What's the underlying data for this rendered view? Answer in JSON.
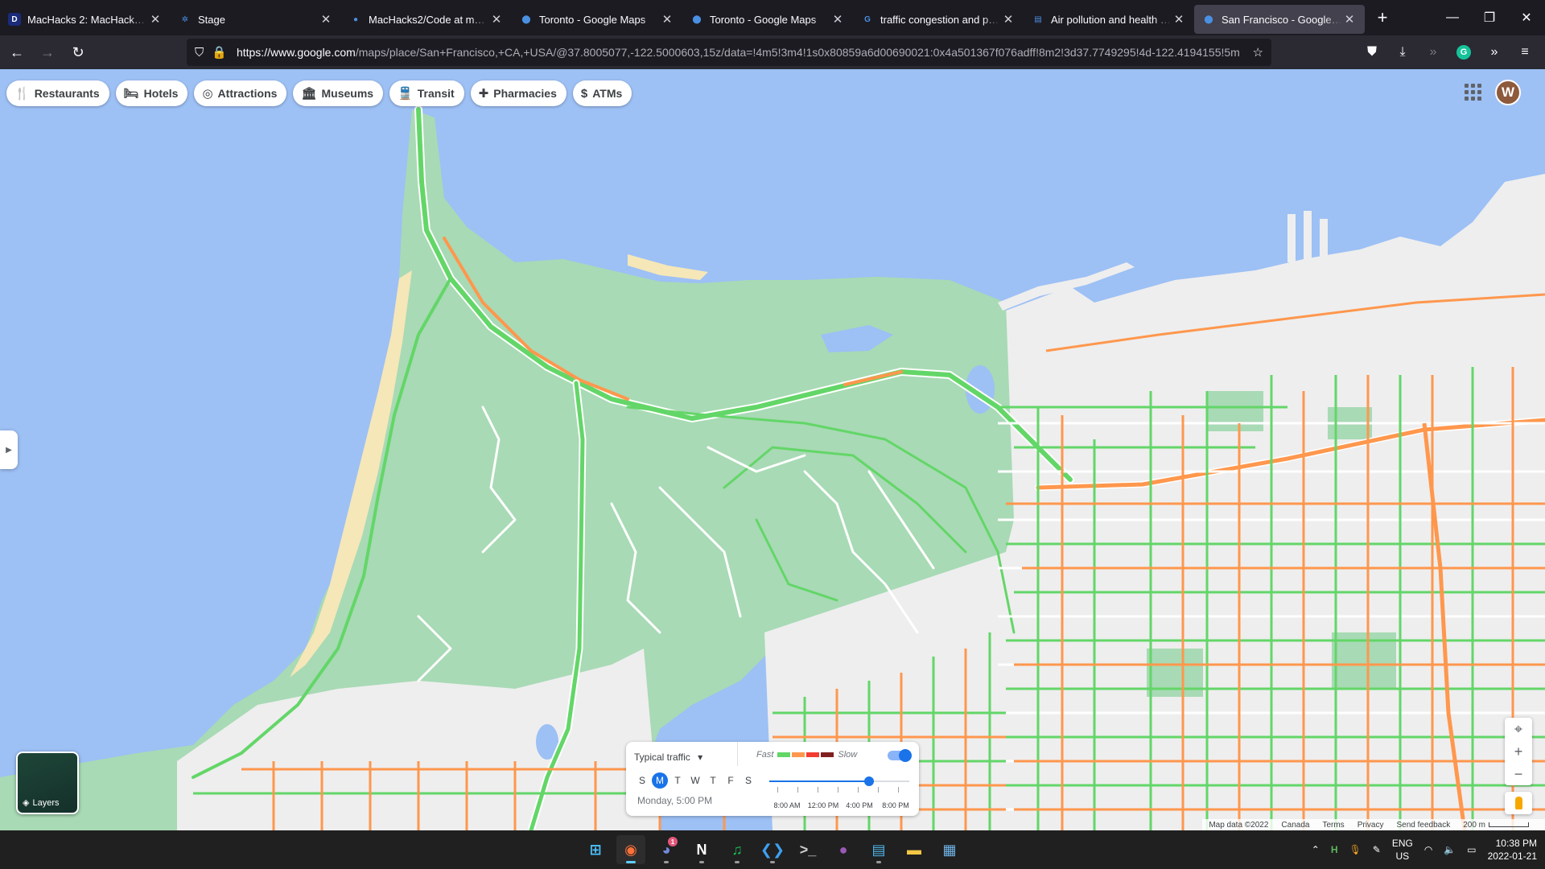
{
  "browser": {
    "tabs": [
      {
        "title": "MacHacks 2: MacHacks 2 is ...",
        "favicon": "D",
        "favicon_bg": "#1a2b7a",
        "active": false
      },
      {
        "title": "Stage",
        "favicon": "✲",
        "favicon_bg": "#1c1b22",
        "active": false
      },
      {
        "title": "MacHacks2/Code at main · d...",
        "favicon": "●",
        "favicon_bg": "#1c1b22",
        "active": false
      },
      {
        "title": "Toronto - Google Maps",
        "favicon": "⬤",
        "favicon_bg": "#1c1b22",
        "active": false
      },
      {
        "title": "Toronto - Google Maps",
        "favicon": "⬤",
        "favicon_bg": "#1c1b22",
        "active": false
      },
      {
        "title": "traffic congestion and polluti...",
        "favicon": "G",
        "favicon_bg": "#1c1b22",
        "active": false
      },
      {
        "title": "Air pollution and health risks ...",
        "favicon": "▤",
        "favicon_bg": "#1c1b22",
        "active": false
      },
      {
        "title": "San Francisco - Google Maps",
        "favicon": "⬤",
        "favicon_bg": "#42414d",
        "active": true
      }
    ],
    "url_host": "https://www.google.com",
    "url_rest": "/maps/place/San+Francisco,+CA,+USA/@37.8005077,-122.5000603,15z/data=!4m5!3m4!1s0x80859a6d00690021:0x4a501367f076adff!8m2!3d37.7749295!4d-122.4194155!5m"
  },
  "maps": {
    "chips": [
      {
        "label": "Restaurants",
        "icon": "fork-knife-icon",
        "glyph": "🍴"
      },
      {
        "label": "Hotels",
        "icon": "bed-icon",
        "glyph": "🛏"
      },
      {
        "label": "Attractions",
        "icon": "camera-icon",
        "glyph": "◎"
      },
      {
        "label": "Museums",
        "icon": "museum-icon",
        "glyph": "🏛"
      },
      {
        "label": "Transit",
        "icon": "train-icon",
        "glyph": "🚆"
      },
      {
        "label": "Pharmacies",
        "icon": "pharmacy-icon",
        "glyph": "✚"
      },
      {
        "label": "ATMs",
        "icon": "atm-icon",
        "glyph": "$"
      }
    ],
    "avatar_letter": "W",
    "layers_label": "Layers",
    "traffic": {
      "mode": "Typical traffic",
      "fast_label": "Fast",
      "slow_label": "Slow",
      "legend_colors": [
        "#63d668",
        "#ff974d",
        "#f23c32",
        "#811f1f"
      ],
      "days": [
        "S",
        "M",
        "T",
        "W",
        "T",
        "F",
        "S"
      ],
      "selected_day_index": 1,
      "when": "Monday, 5:00 PM",
      "time_labels": [
        "8:00 AM",
        "12:00 PM",
        "4:00 PM",
        "8:00 PM"
      ],
      "slider_fraction": 0.71
    },
    "attribution": {
      "map_data": "Map data ©2022",
      "region": "Canada",
      "terms": "Terms",
      "privacy": "Privacy",
      "feedback": "Send feedback",
      "scale": "200 m"
    },
    "colors": {
      "water": "#9dc0f5",
      "park": "#a8dab5",
      "city": "#eeeeee",
      "sand": "#f5e7b8",
      "fast": "#63d668",
      "moderate": "#ff974d"
    }
  },
  "taskbar": {
    "apps": [
      {
        "name": "windows-start-icon",
        "glyph": "⊞",
        "color": "#4cc2ff",
        "active": false,
        "running": false
      },
      {
        "name": "firefox-icon",
        "glyph": "◉",
        "color": "#ff7139",
        "active": true,
        "running": true
      },
      {
        "name": "discord-icon",
        "glyph": "◕",
        "color": "#7289da",
        "active": false,
        "running": true,
        "badge": "1"
      },
      {
        "name": "notion-icon",
        "glyph": "N",
        "color": "#ffffff",
        "active": false,
        "running": true
      },
      {
        "name": "spotify-icon",
        "glyph": "♫",
        "color": "#1db954",
        "active": false,
        "running": true
      },
      {
        "name": "vscode-icon",
        "glyph": "❮❯",
        "color": "#3ea0f0",
        "active": false,
        "running": true
      },
      {
        "name": "terminal-icon",
        "glyph": ">_",
        "color": "#cccccc",
        "active": false,
        "running": false
      },
      {
        "name": "github-desktop-icon",
        "glyph": "●",
        "color": "#9b59b6",
        "active": false,
        "running": false
      },
      {
        "name": "notepad-icon",
        "glyph": "▤",
        "color": "#4fb3e8",
        "active": false,
        "running": true
      },
      {
        "name": "file-explorer-icon",
        "glyph": "▬",
        "color": "#f3c745",
        "active": false,
        "running": false
      },
      {
        "name": "photos-icon",
        "glyph": "▦",
        "color": "#6fb4e8",
        "active": false,
        "running": false
      }
    ],
    "lang_top": "ENG",
    "lang_bottom": "US",
    "time": "10:38 PM",
    "date": "2022-01-21"
  }
}
